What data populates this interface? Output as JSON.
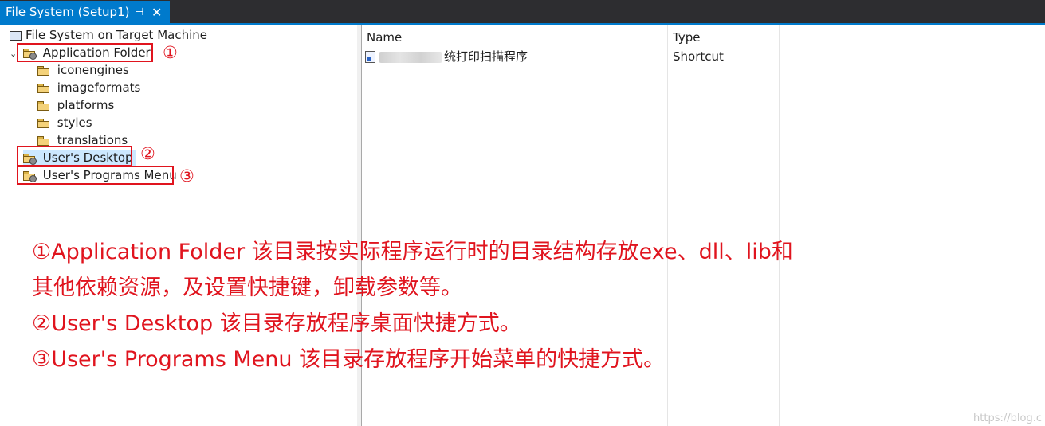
{
  "tab": {
    "title": "File System (Setup1)",
    "pin_glyph": "⊣",
    "close_glyph": "✕"
  },
  "tree": {
    "root": "File System on Target Machine",
    "app_folder": "Application Folder",
    "app_children": [
      "iconengines",
      "imageformats",
      "platforms",
      "styles",
      "translations"
    ],
    "desktop": "User's Desktop",
    "programs_menu": "User's Programs Menu"
  },
  "markers": [
    "①",
    "②",
    "③"
  ],
  "list": {
    "columns": [
      "Name",
      "Type"
    ],
    "rows": [
      {
        "name": "统打印扫描程序",
        "type": "Shortcut"
      }
    ]
  },
  "annotation": {
    "line1": "①Application Folder 该目录按实际程序运行时的目录结构存放exe、dll、lib和",
    "line2": "其他依赖资源，及设置快捷键，卸载参数等。",
    "line3": "②User's Desktop 该目录存放程序桌面快捷方式。",
    "line4": "③User's Programs Menu 该目录存放程序开始菜单的快捷方式。"
  },
  "watermark": "https://blog.c"
}
